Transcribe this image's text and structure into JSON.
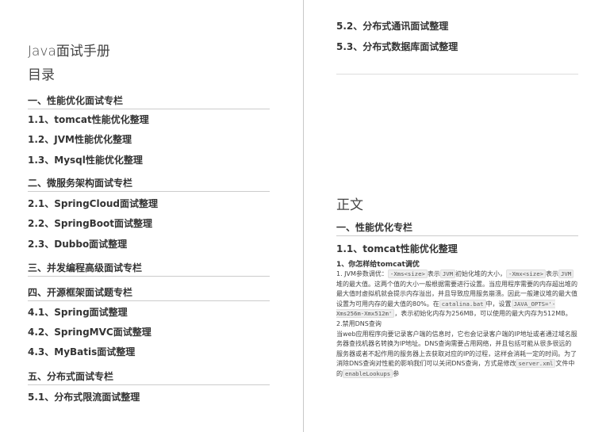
{
  "left_page": {
    "doc_title": "Java面试手册",
    "toc_title": "目录",
    "entries": [
      {
        "text": "一、性能优化面试专栏"
      },
      {
        "text": "1.1、tomcat性能优化整理"
      },
      {
        "text": "1.2、JVM性能优化整理"
      },
      {
        "text": "1.3、Mysql性能优化整理"
      },
      {
        "text": "二、微服务架构面试专栏"
      },
      {
        "text": "2.1、SpringCloud面试整理"
      },
      {
        "text": "2.2、SpringBoot面试整理"
      },
      {
        "text": "2.3、Dubbo面试整理"
      },
      {
        "text": "三、并发编程高级面试专栏"
      },
      {
        "text": "四、开源框架面试题专栏"
      },
      {
        "text": "4.1、Spring面试整理"
      },
      {
        "text": "4.2、SpringMVC面试整理"
      },
      {
        "text": "4.3、MyBatis面试整理"
      },
      {
        "text": "五、分布式面试专栏"
      },
      {
        "text": "5.1、分布式限流面试整理"
      }
    ]
  },
  "right_page": {
    "toc_continued": [
      {
        "text": "5.2、分布式通讯面试整理"
      },
      {
        "text": "5.3、分布式数据库面试整理"
      }
    ],
    "body_heading": "正文",
    "section_title": "一、性能优化专栏",
    "subsection_title": "1.1、tomcat性能优化整理",
    "subsub_title": "1、你怎样给tomcat调优",
    "p1": {
      "t1": "1. JVM参数调优：",
      "c1": "-Xms<size>",
      "t2": "表示",
      "c2": "JVM",
      "t3": "初始化堆的大小，",
      "c3": "-Xmx<size>",
      "t4": "表示",
      "c4": "JVM",
      "t5": "堆的最大值。这两个值的大小一般根据需要进行设置。当应用程序需要的内存超出堆的最大值时虚拟机就会提示内存溢出，并且导致应用服务崩溃。因此一般建议堆的最大值设置为可用内存的最大值的80%。在",
      "c5": "catalina.bat",
      "t6": "中，设置",
      "c6": "JAVA_OPTS='-Xms256m-Xmx512m'",
      "t7": "，表示初始化内存为256MB，可以使用的最大内存为512MB。"
    },
    "p2_title": "2.禁用DNS查询",
    "p3": {
      "t1": "当web应用程序向要记录客户端的信息时，它也会记录客户端的IP地址或者通过域名服务器查找机器名转换为IP地址。DNS查询需要占用网络，并且包括可能从很多很远的服务器或者不起作用的服务器上去获取对应的IP的过程，这样会消耗一定的时间。为了消除DNS查询对性能的影响我们可以关闭DNS查询，方式是修改",
      "c1": "server.xml",
      "t2": "文件中的",
      "c2": "enableLookups",
      "t3": "参"
    }
  }
}
